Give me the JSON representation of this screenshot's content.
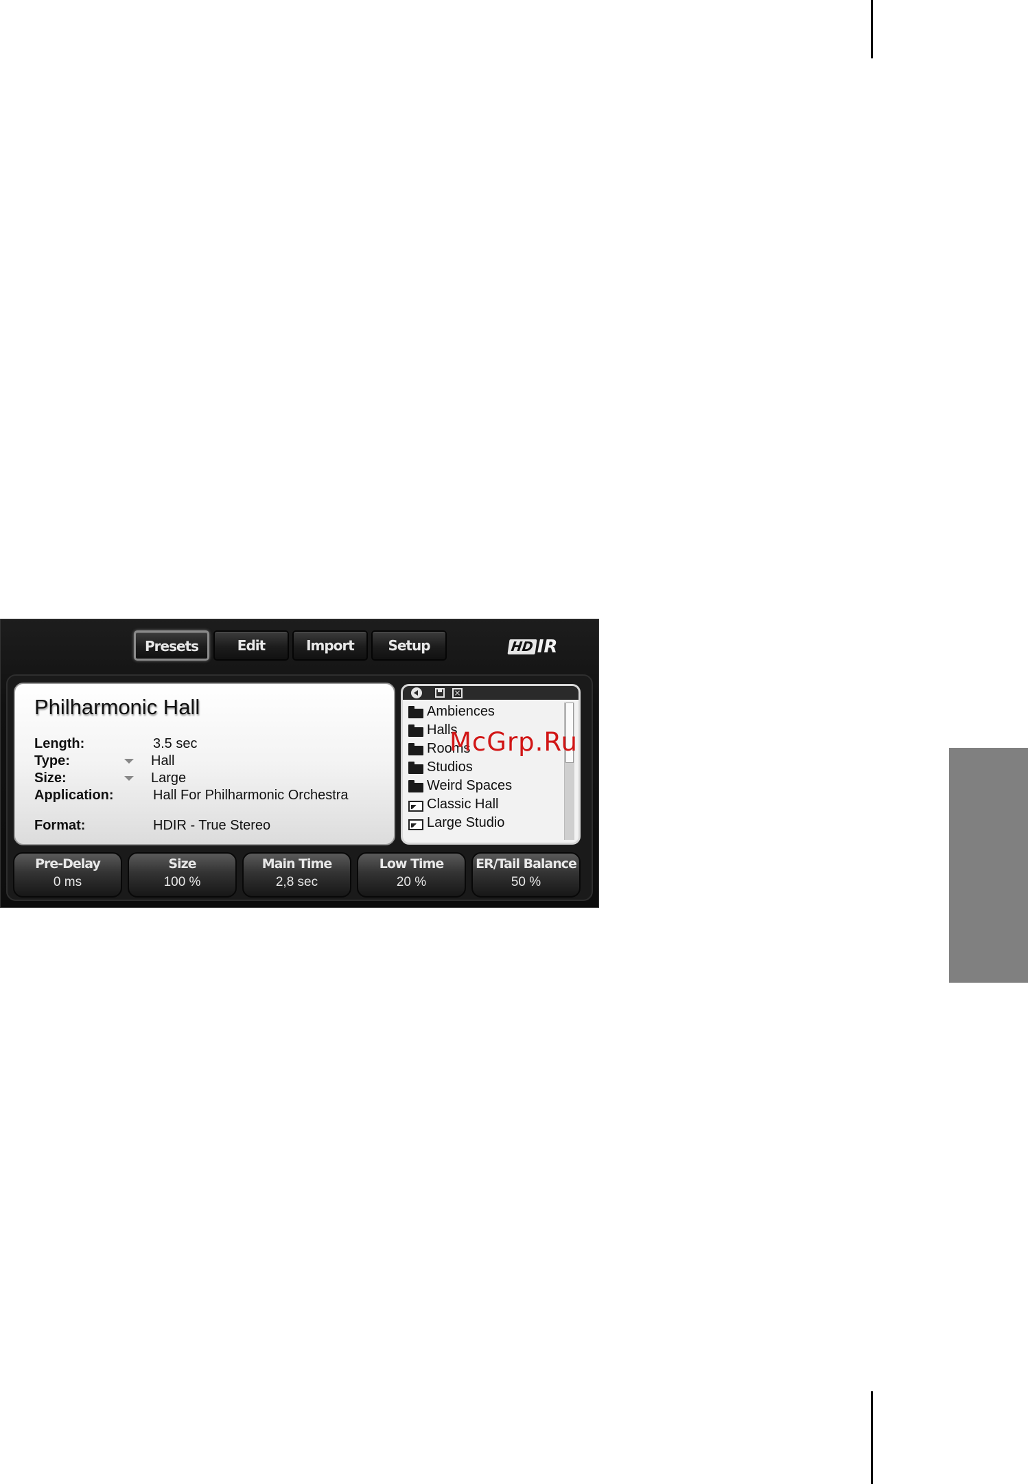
{
  "page": {
    "watermark": "McGrp.Ru"
  },
  "toolbar": {
    "tabs": [
      {
        "label": "Presets",
        "active": true
      },
      {
        "label": "Edit",
        "active": false
      },
      {
        "label": "Import",
        "active": false
      },
      {
        "label": "Setup",
        "active": false
      }
    ],
    "logo": {
      "hd": "HD",
      "ir": "IR"
    }
  },
  "preset_info": {
    "title": "Philharmonic Hall",
    "length": {
      "label": "Length:",
      "value": "3.5 sec"
    },
    "type": {
      "label": "Type:",
      "value": "Hall"
    },
    "size": {
      "label": "Size:",
      "value": "Large"
    },
    "application": {
      "label": "Application:",
      "value": "Hall For Philharmonic Orchestra"
    },
    "format": {
      "label": "Format:",
      "value": "HDIR - True Stereo"
    }
  },
  "browser": {
    "icons": [
      "back-icon",
      "save-icon",
      "close-icon"
    ],
    "items": [
      {
        "label": "Ambiences",
        "kind": "folder"
      },
      {
        "label": "Halls",
        "kind": "folder"
      },
      {
        "label": "Rooms",
        "kind": "folder"
      },
      {
        "label": "Studios",
        "kind": "folder"
      },
      {
        "label": "Weird Spaces",
        "kind": "folder"
      },
      {
        "label": "Classic Hall",
        "kind": "preset"
      },
      {
        "label": "Large Studio",
        "kind": "preset"
      }
    ],
    "scroll_position": 0
  },
  "params": [
    {
      "name": "Pre-Delay",
      "value": "0 ms"
    },
    {
      "name": "Size",
      "value": "100 %"
    },
    {
      "name": "Main Time",
      "value": "2,8 sec"
    },
    {
      "name": "Low Time",
      "value": "20 %"
    },
    {
      "name": "ER/Tail Balance",
      "value": "50 %"
    }
  ],
  "colors": {
    "panel_bg": "#111111",
    "info_bg": "#f3f3f3",
    "tab_tab": "#808080",
    "watermark": "#d11616"
  }
}
